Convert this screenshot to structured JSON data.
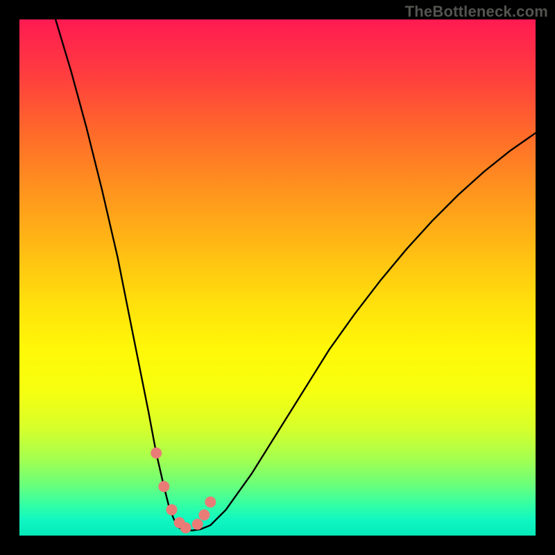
{
  "watermark": "TheBottleneck.com",
  "chart_data": {
    "type": "line",
    "title": "",
    "xlabel": "",
    "ylabel": "",
    "xlim": [
      0,
      100
    ],
    "ylim": [
      0,
      100
    ],
    "series": [
      {
        "name": "bottleneck-curve",
        "x": [
          7,
          10,
          13,
          16,
          19,
          21,
          23,
          25,
          26.5,
          28,
          29,
          30,
          31,
          32,
          33.5,
          35,
          37,
          40,
          45,
          50,
          55,
          60,
          65,
          70,
          75,
          80,
          85,
          90,
          95,
          100
        ],
        "y": [
          100,
          90,
          79,
          67,
          54,
          44,
          34,
          24,
          16,
          9.5,
          5.5,
          3,
          1.5,
          1,
          1,
          1.2,
          2,
          5,
          12,
          20,
          28,
          36,
          43,
          49.5,
          55.5,
          61,
          66,
          70.5,
          74.5,
          78
        ]
      }
    ],
    "markers": {
      "name": "highlight-points",
      "x": [
        26.5,
        28,
        29.5,
        31,
        32.2,
        34.5,
        35.8,
        37
      ],
      "y": [
        16,
        9.5,
        5,
        2.5,
        1.5,
        2.2,
        4,
        6.5
      ]
    },
    "background_gradient": {
      "top": "#ff1a52",
      "middle": "#fff808",
      "bottom": "#06e8b9"
    },
    "marker_color": "#e97c77",
    "curve_color": "#000000"
  }
}
